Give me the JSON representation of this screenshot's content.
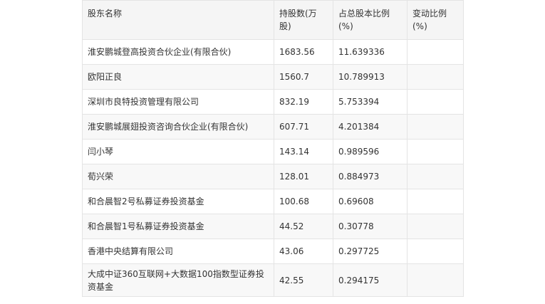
{
  "table": {
    "headers": [
      "股东名称",
      "持股数(万股)",
      "占总股本比例(%)",
      "变动比例(%)"
    ],
    "rows": [
      {
        "name": "淮安鹏城登高投资合伙企业(有限合伙)",
        "shares": "1683.56",
        "ratio": "11.639336",
        "change": ""
      },
      {
        "name": "欧阳正良",
        "shares": "1560.7",
        "ratio": "10.789913",
        "change": ""
      },
      {
        "name": "深圳市良特投资管理有限公司",
        "shares": "832.19",
        "ratio": "5.753394",
        "change": ""
      },
      {
        "name": "淮安鹏城展翅投资咨询合伙企业(有限合伙)",
        "shares": "607.71",
        "ratio": "4.201384",
        "change": ""
      },
      {
        "name": "闫小琴",
        "shares": "143.14",
        "ratio": "0.989596",
        "change": ""
      },
      {
        "name": "荀兴荣",
        "shares": "128.01",
        "ratio": "0.884973",
        "change": ""
      },
      {
        "name": "和合晨智2号私募证券投资基金",
        "shares": "100.68",
        "ratio": "0.69608",
        "change": ""
      },
      {
        "name": "和合晨智1号私募证券投资基金",
        "shares": "44.52",
        "ratio": "0.30778",
        "change": ""
      },
      {
        "name": "香港中央结算有限公司",
        "shares": "43.06",
        "ratio": "0.297725",
        "change": ""
      },
      {
        "name": "大成中证360互联网+大数据100指数型证券投资基金",
        "shares": "42.55",
        "ratio": "0.294175",
        "change": ""
      }
    ]
  }
}
